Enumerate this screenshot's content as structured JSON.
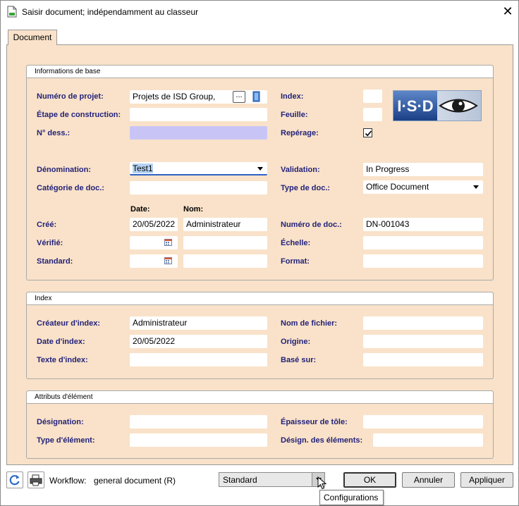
{
  "window": {
    "title": "Saisir document; indépendamment au classeur",
    "close_glyph": "✕"
  },
  "tab": {
    "label": "Document"
  },
  "groups": {
    "base": "Informations de base",
    "index": "Index",
    "attributes": "Attributs d'élément"
  },
  "base": {
    "project_number": {
      "label": "Numéro de projet:",
      "value": "Projets de ISD Group,",
      "browse": "..."
    },
    "construction_stage": {
      "label": "Étape de construction:",
      "value": ""
    },
    "drawing_number": {
      "label": "N° dess.:",
      "value": ""
    },
    "index": {
      "label": "Index:",
      "value": ""
    },
    "sheet": {
      "label": "Feuille:",
      "value": ""
    },
    "marking": {
      "label": "Repérage:",
      "checked": true
    },
    "denomination": {
      "label": "Dénomination:",
      "value": "Test1"
    },
    "doc_category": {
      "label": "Catégorie de doc.:",
      "value": ""
    },
    "validation": {
      "label": "Validation:",
      "value": "In Progress"
    },
    "doc_type": {
      "label": "Type de doc.:",
      "value": "Office Document"
    },
    "col_date": "Date:",
    "col_name": "Nom:",
    "created": {
      "label": "Créé:",
      "date": "20/05/2022",
      "name": "Administrateur"
    },
    "checked_row": {
      "label": "Vérifié:",
      "date": "",
      "name": ""
    },
    "standard_row": {
      "label": "Standard:",
      "date": "",
      "name": ""
    },
    "doc_number": {
      "label": "Numéro de doc.:",
      "value": "DN-001043"
    },
    "scale": {
      "label": "Échelle:",
      "value": ""
    },
    "format": {
      "label": "Format:",
      "value": ""
    },
    "logo_text": "I·S·D"
  },
  "index": {
    "creator": {
      "label": "Créateur d'index:",
      "value": "Administrateur"
    },
    "date": {
      "label": "Date d'index:",
      "value": "20/05/2022"
    },
    "text": {
      "label": "Texte d'index:",
      "value": ""
    },
    "filename": {
      "label": "Nom de fichier:",
      "value": ""
    },
    "origin": {
      "label": "Origine:",
      "value": ""
    },
    "based_on": {
      "label": "Basé sur:",
      "value": ""
    }
  },
  "attributes": {
    "designation": {
      "label": "Désignation:",
      "value": ""
    },
    "element_type": {
      "label": "Type d'élément:",
      "value": ""
    },
    "sheet_thickness": {
      "label": "Épaisseur de tôle:",
      "value": ""
    },
    "element_designation": {
      "label": "Désign. des éléments:",
      "value": ""
    }
  },
  "footer": {
    "workflow_label": "Workflow:",
    "workflow_value": "general document (R)",
    "standard_combo": "Standard",
    "ok": "OK",
    "cancel": "Annuler",
    "apply": "Appliquer",
    "tooltip": "Configurations"
  },
  "colors": {
    "panel": "#f9e2c9",
    "label": "#23227a",
    "lavender": "#c8c5f6"
  }
}
